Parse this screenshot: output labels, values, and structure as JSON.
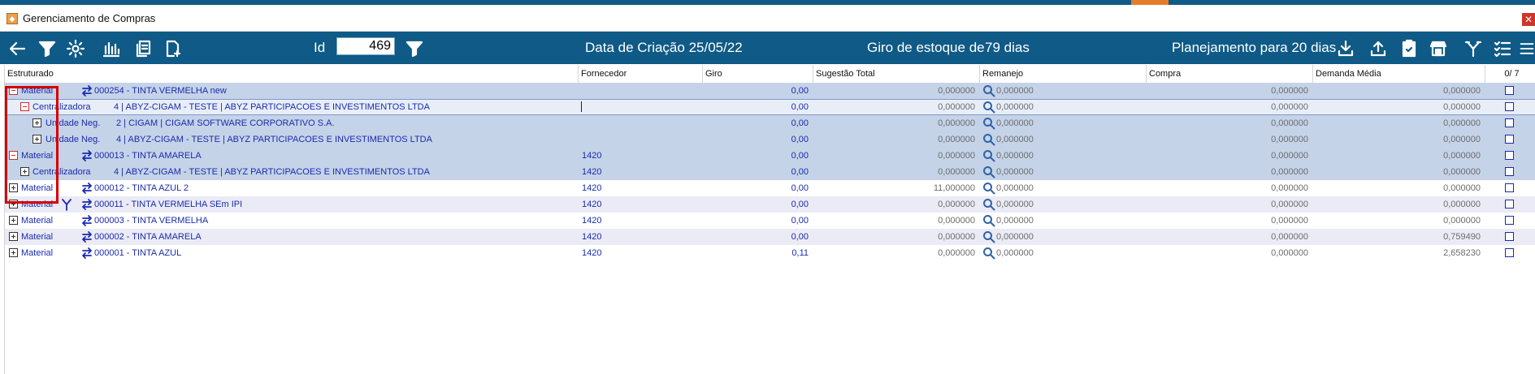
{
  "window": {
    "title": "Gerenciamento de Compras",
    "app_icon": "app-logo-icon",
    "close_icon": "close-icon"
  },
  "toolbar": {
    "id_label": "Id",
    "id_value": "469",
    "creation_label": "Data de Criação 25/05/22",
    "stock_turn_label": "Giro de estoque de",
    "stock_turn_value": "79 dias",
    "planning_label": "Planejamento para 20 dias",
    "icons": [
      "back-arrow-icon",
      "filter-icon",
      "gear-icon",
      "bar-chart-icon",
      "copy-icon",
      "new-document-icon",
      "id-filter-icon",
      "download-icon",
      "upload-icon",
      "clipboard-check-icon",
      "shop-icon",
      "fork-icon",
      "checklist-icon",
      "menu-icon"
    ]
  },
  "colors": {
    "toolbar_bg": "#0f5a86",
    "accent": "#e57c2b",
    "selected_row": "#c5d3e8",
    "alt_row": "#ebebf6",
    "link_text": "#1a2bb0",
    "highlight_border": "#d40000"
  },
  "grid": {
    "columns": {
      "estruturado": "Estruturado",
      "fornecedor": "Fornecedor",
      "giro": "Giro",
      "sugestao_total": "Sugestão Total",
      "remanejo": "Remanejo",
      "compra": "Compra",
      "demanda_media": "Demanda Média",
      "selected_count": "0/ 7"
    },
    "rows": [
      {
        "level": 0,
        "expander": "minus",
        "type": "Material",
        "icon": "swap",
        "code": "000254 - TINTA VERMELHA new",
        "fornecedor": "",
        "giro": "0,00",
        "sugestao": "0,000000",
        "remanejo": "0,000000",
        "compra": "0,000000",
        "demanda": "0,000000",
        "style": "sel"
      },
      {
        "level": 1,
        "expander": "minus",
        "type": "Centralizadora",
        "icon": "",
        "code": "4   | ABYZ-CIGAM - TESTE | ABYZ PARTICIPACOES E INVESTIMENTOS LTDA",
        "fornecedor": "",
        "giro": "0,00",
        "sugestao": "0,000000",
        "remanejo": "0,000000",
        "compra": "0,000000",
        "demanda": "0,000000",
        "style": "focus"
      },
      {
        "level": 2,
        "expander": "plus",
        "type": "Unidade Neg.",
        "icon": "",
        "code": "2 | CIGAM | CIGAM SOFTWARE CORPORATIVO S.A.",
        "fornecedor": "",
        "giro": "0,00",
        "sugestao": "0,000000",
        "remanejo": "0,000000",
        "compra": "0,000000",
        "demanda": "0,000000",
        "style": "sel"
      },
      {
        "level": 2,
        "expander": "plus",
        "type": "Unidade Neg.",
        "icon": "",
        "code": "4 | ABYZ-CIGAM - TESTE | ABYZ PARTICIPACOES E INVESTIMENTOS LTDA",
        "fornecedor": "",
        "giro": "0,00",
        "sugestao": "0,000000",
        "remanejo": "0,000000",
        "compra": "0,000000",
        "demanda": "0,000000",
        "style": "sel"
      },
      {
        "level": 0,
        "expander": "minus",
        "type": "Material",
        "icon": "swap",
        "code": "000013 - TINTA AMARELA",
        "fornecedor": "1420",
        "giro": "0,00",
        "sugestao": "0,000000",
        "remanejo": "0,000000",
        "compra": "0,000000",
        "demanda": "0,000000",
        "style": "sel"
      },
      {
        "level": 1,
        "expander": "plus",
        "type": "Centralizadora",
        "icon": "",
        "code": "4   | ABYZ-CIGAM - TESTE | ABYZ PARTICIPACOES E INVESTIMENTOS LTDA",
        "fornecedor": "1420",
        "giro": "0,00",
        "sugestao": "0,000000",
        "remanejo": "0,000000",
        "compra": "0,000000",
        "demanda": "0,000000",
        "style": "sel"
      },
      {
        "level": 0,
        "expander": "plus",
        "type": "Material",
        "icon": "swap",
        "code": "000012 - TINTA AZUL 2",
        "fornecedor": "1420",
        "giro": "0,00",
        "sugestao": "11,000000",
        "remanejo": "0,000000",
        "compra": "0,000000",
        "demanda": "0,000000",
        "style": "odd"
      },
      {
        "level": 0,
        "expander": "plus",
        "type": "Material",
        "icon": "swap",
        "fork": true,
        "code": "000011 - TINTA VERMELHA SEm IPI",
        "fornecedor": "1420",
        "giro": "0,00",
        "sugestao": "0,000000",
        "remanejo": "0,000000",
        "compra": "0,000000",
        "demanda": "0,000000",
        "style": "even"
      },
      {
        "level": 0,
        "expander": "plus",
        "type": "Material",
        "icon": "swap",
        "code": "000003 - TINTA VERMELHA",
        "fornecedor": "1420",
        "giro": "0,00",
        "sugestao": "0,000000",
        "remanejo": "0,000000",
        "compra": "0,000000",
        "demanda": "0,000000",
        "style": "odd"
      },
      {
        "level": 0,
        "expander": "plus",
        "type": "Material",
        "icon": "swap",
        "code": "000002 - TINTA AMARELA",
        "fornecedor": "1420",
        "giro": "0,00",
        "sugestao": "0,000000",
        "remanejo": "0,000000",
        "compra": "0,000000",
        "demanda": "0,759490",
        "style": "even"
      },
      {
        "level": 0,
        "expander": "plus",
        "type": "Material",
        "icon": "swap",
        "code": "000001 - TINTA AZUL",
        "fornecedor": "1420",
        "giro": "0,11",
        "sugestao": "0,000000",
        "remanejo": "0,000000",
        "compra": "0,000000",
        "demanda": "2,658230",
        "style": "odd"
      }
    ]
  }
}
